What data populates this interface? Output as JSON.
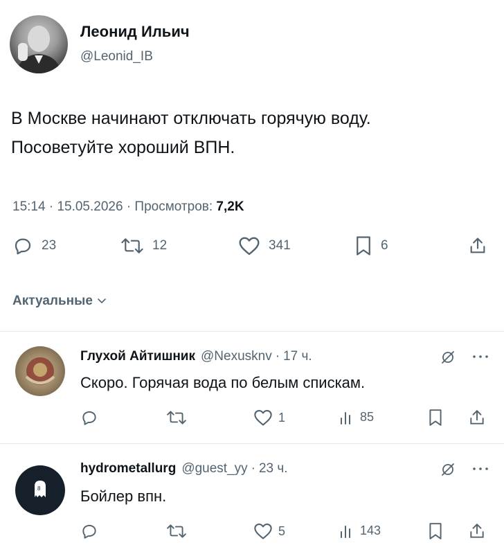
{
  "tweet": {
    "author_name": "Леонид Ильич",
    "author_handle": "@Leonid_IB",
    "text": "В Москве начинают отключать горячую воду.\nПосоветуйте хороший ВПН.",
    "time": "15:14",
    "date": "15.05.2026",
    "views_label": "Просмотров:",
    "views_count": "7,2K",
    "actions": {
      "replies": "23",
      "retweets": "12",
      "likes": "341",
      "bookmarks": "6"
    }
  },
  "sort_label": "Актуальные",
  "replies": [
    {
      "name": "Глухой Айтишник",
      "handle": "@Nexusknv",
      "time": "17 ч.",
      "text": "Скоро. Горячая вода по белым спискам.",
      "retweets": "",
      "likes": "1",
      "views": "85"
    },
    {
      "name": "hydrometallurg",
      "handle": "@guest_yy",
      "time": "23 ч.",
      "text": "Бойлер впн.",
      "retweets": "",
      "likes": "5",
      "views": "143"
    }
  ],
  "separator": "·",
  "colors": {
    "text": "#0f1419",
    "muted": "#536471",
    "divider": "#e6e9ec"
  }
}
